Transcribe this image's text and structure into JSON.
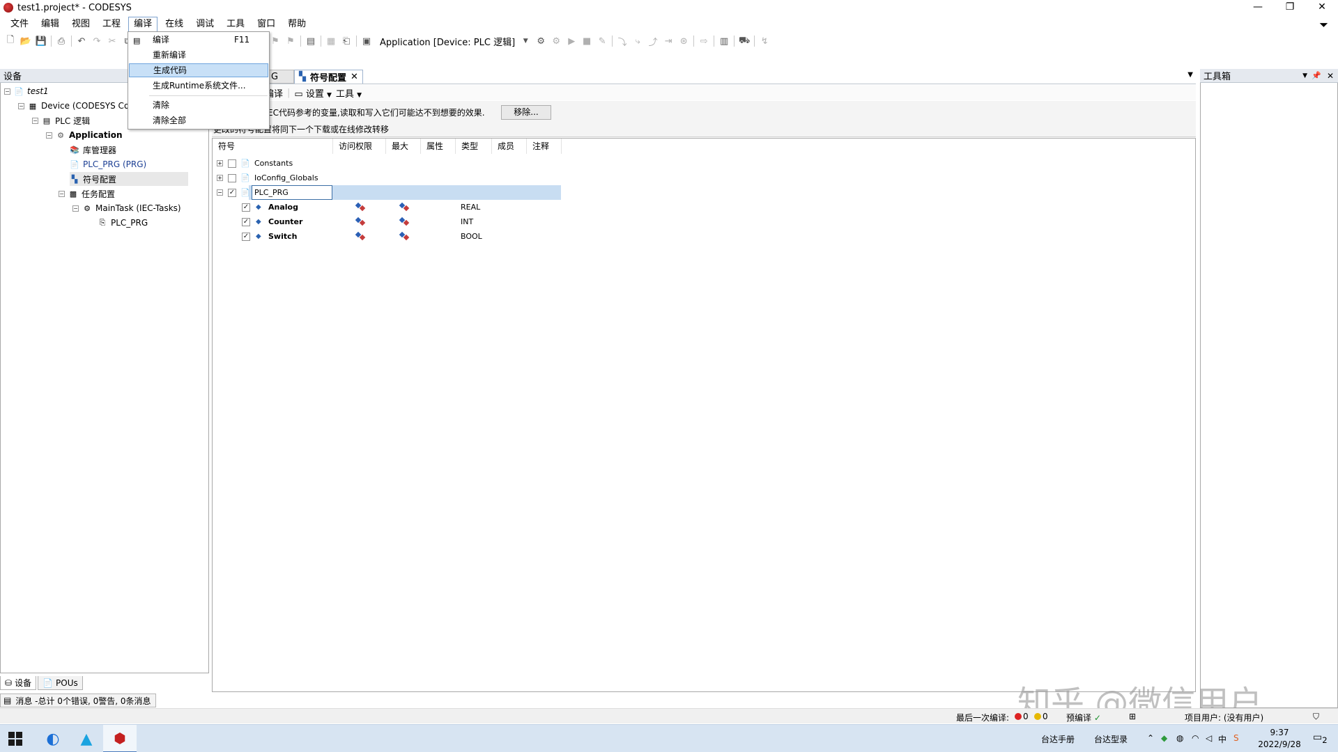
{
  "window": {
    "title": "test1.project* - CODESYS",
    "controls": [
      "—",
      "❐",
      "✕"
    ]
  },
  "menubar": {
    "items": [
      "文件",
      "编辑",
      "视图",
      "工程",
      "编译",
      "在线",
      "调试",
      "工具",
      "窗口",
      "帮助"
    ],
    "active": "编译"
  },
  "toolbar": {
    "application_selector": "Application [Device: PLC 逻辑]"
  },
  "compile_menu": {
    "items": [
      {
        "label": "编译",
        "shortcut": "F11"
      },
      {
        "label": "重新编译",
        "shortcut": ""
      },
      {
        "label": "生成代码",
        "shortcut": ""
      },
      {
        "label": "生成Runtime系统文件...",
        "shortcut": ""
      },
      {
        "label": "清除",
        "shortcut": ""
      },
      {
        "label": "清除全部",
        "shortcut": ""
      }
    ],
    "highlighted": "生成代码"
  },
  "left_panel": {
    "title": "设备",
    "tree": [
      {
        "label": "test1"
      },
      {
        "label": "Device (CODESYS Contro"
      },
      {
        "label": "PLC 逻辑"
      },
      {
        "label": "Application"
      },
      {
        "label": "库管理器"
      },
      {
        "label": "PLC_PRG (PRG)"
      },
      {
        "label": "符号配置"
      },
      {
        "label": "任务配置"
      },
      {
        "label": "MainTask (IEC-Tasks)"
      },
      {
        "label": "PLC_PRG"
      }
    ],
    "tabs": [
      "设备",
      "POUs"
    ]
  },
  "right_panel": {
    "title": "工具箱"
  },
  "editor": {
    "tabs": [
      {
        "label": "G"
      },
      {
        "label": "符号配置"
      }
    ],
    "toolbar": {
      "compile": "编译",
      "settings": "设置",
      "tools": "工具"
    },
    "info": {
      "line1": "EC代码参考的变量,读取和写入它们可能达不到想要的效果.",
      "remove_button": "移除...",
      "line2": "更改的符号配置将同下一个下载或在线修改转移"
    },
    "columns": [
      "符号",
      "访问权限",
      "最大",
      "属性",
      "类型",
      "成员",
      "注释"
    ],
    "rows": [
      {
        "name": "Constants",
        "checked": false,
        "expand": "+",
        "type": ""
      },
      {
        "name": "IoConfig_Globals",
        "checked": false,
        "expand": "+",
        "type": ""
      },
      {
        "name": "PLC_PRG",
        "checked": true,
        "expand": "−",
        "type": ""
      },
      {
        "name": "Analog",
        "checked": true,
        "type": "REAL"
      },
      {
        "name": "Counter",
        "checked": true,
        "type": "INT"
      },
      {
        "name": "Switch",
        "checked": true,
        "type": "BOOL"
      }
    ]
  },
  "messages": {
    "text": "消息 -总计 0个错误, 0警告, 0条消息"
  },
  "statusbar": {
    "last_compile_label": "最后一次编译:",
    "errors": "0",
    "warnings": "0",
    "precompile": "预编译",
    "project_user": "项目用户: (没有用户)"
  },
  "watermark": "知乎 @微信用户",
  "taskbar": {
    "tray_items": [
      "台达手册",
      "台达型录"
    ],
    "ime": "中",
    "time": "9:37",
    "date": "2022/9/28",
    "notifications": "2"
  },
  "colors": {
    "menu_highlight": "#c8e0f7",
    "selection": "#c8ddf2",
    "taskbar": "#d7e4f2"
  }
}
